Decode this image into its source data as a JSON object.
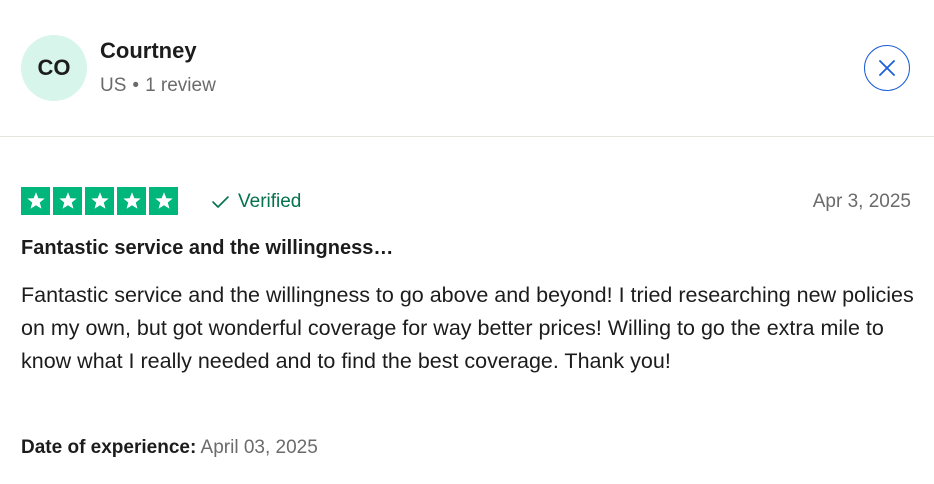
{
  "reviewer": {
    "initials": "CO",
    "name": "Courtney",
    "country": "US",
    "separator": "•",
    "review_count": "1 review"
  },
  "close_button": {
    "icon": "close-icon",
    "color": "#1c5fd6"
  },
  "review": {
    "rating": 5,
    "rating_max": 5,
    "star_color": "#00b67a",
    "verified_label": "Verified",
    "verified_color": "#04724d",
    "date": "Apr 3, 2025",
    "title": "Fantastic service and the willingness…",
    "body": "Fantastic service and the willingness to go above and beyond! I tried researching new policies on my own, but got wonderful coverage for way better prices! Willing to go the extra mile to know what I really needed and to find the best coverage. Thank you!",
    "date_of_experience_label": "Date of experience:",
    "date_of_experience": "April 03, 2025"
  },
  "colors": {
    "avatar_bg": "#d7f5ea",
    "divider": "#e5e5dd"
  }
}
